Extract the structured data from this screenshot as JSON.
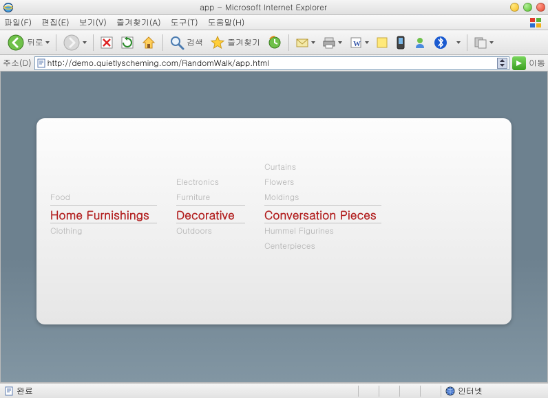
{
  "window": {
    "title": "app - Microsoft Internet Explorer"
  },
  "menu": {
    "file": "파일(F)",
    "edit": "편집(E)",
    "view": "보기(V)",
    "fav": "즐겨찾기(A)",
    "tools": "도구(T)",
    "help": "도움말(H)"
  },
  "toolbar": {
    "back": "뒤로",
    "search": "검색",
    "favorites": "즐겨찾기"
  },
  "address": {
    "label": "주소(D)",
    "url": "http://demo.quietlyscheming.com/RandomWalk/app.html",
    "go": "이동"
  },
  "nav": {
    "col1": {
      "above": [
        "Food"
      ],
      "selected": "Home Furnishings",
      "below": [
        "Clothing"
      ]
    },
    "col2": {
      "above": [
        "Electronics",
        "Furniture"
      ],
      "selected": "Decorative",
      "below": [
        "Outdoors"
      ]
    },
    "col3": {
      "above": [
        "Curtains",
        "Flowers",
        "Moldings"
      ],
      "selected": "Conversation Pieces",
      "below": [
        "Hummel Figurines",
        "Centerpieces"
      ]
    }
  },
  "status": {
    "done": "완료",
    "zone": "인터넷"
  }
}
